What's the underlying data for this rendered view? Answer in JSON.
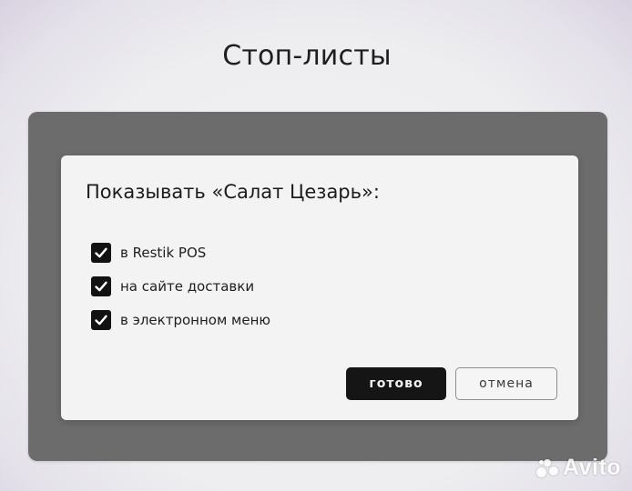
{
  "page": {
    "title": "Стоп-листы"
  },
  "dialog": {
    "title": "Показывать «Салат Цезарь»:",
    "options": [
      {
        "label": "в Restik POS",
        "checked": true
      },
      {
        "label": "на сайте доставки",
        "checked": true
      },
      {
        "label": "в электронном меню",
        "checked": true
      }
    ],
    "buttons": {
      "done_label": "готово",
      "cancel_label": "отмена"
    }
  },
  "watermark": {
    "text": "Avito",
    "icon": "avito-logo-icon"
  },
  "colors": {
    "overlay": "#6c6c6c",
    "dialog_background": "#f3f3f3",
    "checkbox": "#121212",
    "primary_button": "#151515"
  }
}
